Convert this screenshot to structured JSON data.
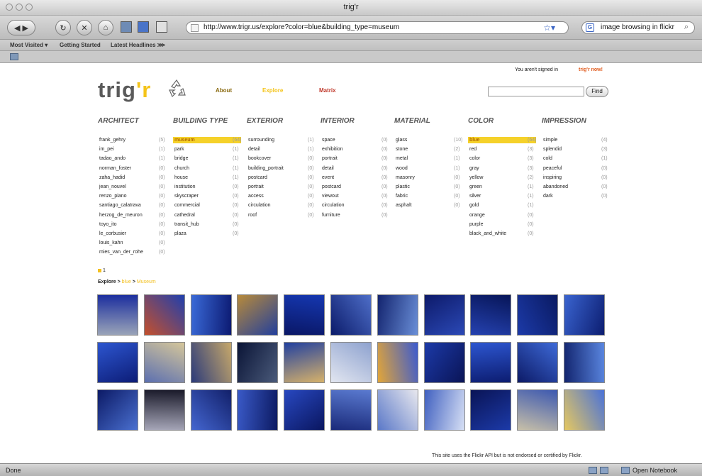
{
  "window": {
    "title": "trig'r"
  },
  "toolbar": {
    "url": "http://www.trigr.us/explore?color=blue&building_type=museum",
    "search": "image browsing in flickr"
  },
  "bookmarks": {
    "most_visited": "Most Visited ▾",
    "getting_started": "Getting Started",
    "latest_headlines": "Latest Headlines ⋙"
  },
  "status": {
    "done": "Done",
    "notebook": "Open Notebook"
  },
  "header": {
    "signin_text": "You aren't signed in",
    "signin_link": "trig'r now!",
    "logo_main": "trig",
    "logo_accent": "'r",
    "nav": [
      {
        "label": "About",
        "color": "#8a6a10"
      },
      {
        "label": "Explore",
        "color": "#f4c41a"
      },
      {
        "label": "Matrix",
        "color": "#c0392b"
      }
    ],
    "find_label": "Find"
  },
  "facets": [
    {
      "title": "ARCHITECT",
      "items": [
        {
          "name": "frank_gehry",
          "count": "(5)"
        },
        {
          "name": "im_pei",
          "count": "(1)"
        },
        {
          "name": "tadao_ando",
          "count": "(1)"
        },
        {
          "name": "norman_foster",
          "count": "(0)"
        },
        {
          "name": "zaha_hadid",
          "count": "(0)"
        },
        {
          "name": "jean_nouvel",
          "count": "(0)"
        },
        {
          "name": "renzo_piano",
          "count": "(0)"
        },
        {
          "name": "santiago_calatrava",
          "count": "(0)"
        },
        {
          "name": "herzog_de_meuron",
          "count": "(0)"
        },
        {
          "name": "toyo_ito",
          "count": "(0)"
        },
        {
          "name": "le_corbusier",
          "count": "(0)"
        },
        {
          "name": "louis_kahn",
          "count": "(0)"
        },
        {
          "name": "mies_van_der_rohe",
          "count": "(0)"
        }
      ]
    },
    {
      "title": "BUILDING TYPE",
      "items": [
        {
          "name": "museum",
          "count": "(64)",
          "selected": true
        },
        {
          "name": "park",
          "count": "(1)"
        },
        {
          "name": "bridge",
          "count": "(1)"
        },
        {
          "name": "church",
          "count": "(1)"
        },
        {
          "name": "house",
          "count": "(1)"
        },
        {
          "name": "institution",
          "count": "(0)"
        },
        {
          "name": "skyscraper",
          "count": "(0)"
        },
        {
          "name": "commercial",
          "count": "(0)"
        },
        {
          "name": "cathedral",
          "count": "(0)"
        },
        {
          "name": "transit_hub",
          "count": "(0)"
        },
        {
          "name": "plaza",
          "count": "(0)"
        }
      ]
    },
    {
      "title": "EXTERIOR",
      "items": [
        {
          "name": "surrounding",
          "count": "(1)"
        },
        {
          "name": "detail",
          "count": "(1)"
        },
        {
          "name": "bookcover",
          "count": "(0)"
        },
        {
          "name": "building_portrait",
          "count": "(0)"
        },
        {
          "name": "postcard",
          "count": "(0)"
        },
        {
          "name": "portrait",
          "count": "(0)"
        },
        {
          "name": "access",
          "count": "(0)"
        },
        {
          "name": "circulation",
          "count": "(0)"
        },
        {
          "name": "roof",
          "count": "(0)"
        }
      ]
    },
    {
      "title": "INTERIOR",
      "items": [
        {
          "name": "space",
          "count": "(0)"
        },
        {
          "name": "exhibition",
          "count": "(0)"
        },
        {
          "name": "portrait",
          "count": "(0)"
        },
        {
          "name": "detail",
          "count": "(0)"
        },
        {
          "name": "event",
          "count": "(0)"
        },
        {
          "name": "postcard",
          "count": "(0)"
        },
        {
          "name": "viewout",
          "count": "(0)"
        },
        {
          "name": "circulation",
          "count": "(0)"
        },
        {
          "name": "furniture",
          "count": "(0)"
        }
      ]
    },
    {
      "title": "MATERIAL",
      "items": [
        {
          "name": "glass",
          "count": "(10)"
        },
        {
          "name": "stone",
          "count": "(2)"
        },
        {
          "name": "metal",
          "count": "(1)"
        },
        {
          "name": "wood",
          "count": "(1)"
        },
        {
          "name": "masonry",
          "count": "(0)"
        },
        {
          "name": "plastic",
          "count": "(0)"
        },
        {
          "name": "fabric",
          "count": "(0)"
        },
        {
          "name": "asphalt",
          "count": "(0)"
        }
      ]
    },
    {
      "title": "COLOR",
      "items": [
        {
          "name": "blue",
          "count": "(64)",
          "selected": true
        },
        {
          "name": "red",
          "count": "(3)"
        },
        {
          "name": "color",
          "count": "(3)"
        },
        {
          "name": "gray",
          "count": "(3)"
        },
        {
          "name": "yellow",
          "count": "(2)"
        },
        {
          "name": "green",
          "count": "(1)"
        },
        {
          "name": "silver",
          "count": "(1)"
        },
        {
          "name": "gold",
          "count": "(1)"
        },
        {
          "name": "orange",
          "count": "(0)"
        },
        {
          "name": "purple",
          "count": "(0)"
        },
        {
          "name": "black_and_white",
          "count": "(0)"
        }
      ]
    },
    {
      "title": "IMPRESSION",
      "items": [
        {
          "name": "simple",
          "count": "(4)"
        },
        {
          "name": "splendid",
          "count": "(3)"
        },
        {
          "name": "cold",
          "count": "(1)"
        },
        {
          "name": "peaceful",
          "count": "(0)"
        },
        {
          "name": "inspiring",
          "count": "(0)"
        },
        {
          "name": "abandoned",
          "count": "(0)"
        },
        {
          "name": "dark",
          "count": "(0)"
        }
      ]
    }
  ],
  "pager": {
    "page": "1"
  },
  "breadcrumb": {
    "root": "Explore > ",
    "color": "blue",
    "sep": " > ",
    "type": "Museum"
  },
  "thumbnails": [
    [
      "#9aa4b8",
      "#1c2e9e"
    ],
    [
      "#c5502c",
      "#1f3fae"
    ],
    [
      "#3a6ad8",
      "#0c1a72"
    ],
    [
      "#b78a3a",
      "#223f9c"
    ],
    [
      "#1537b0",
      "#0a1766"
    ],
    [
      "#4e6ec8",
      "#0b1b6a"
    ],
    [
      "#6a8fd8",
      "#13246f"
    ],
    [
      "#2b49b6",
      "#0d1a6a"
    ],
    [
      "#2542b0",
      "#071558"
    ],
    [
      "#1c3aa8",
      "#0a1a62"
    ],
    [
      "#3a64d0",
      "#0c1d70"
    ],
    [
      "#2d56d0",
      "#0c1c76"
    ],
    [
      "#d6c79a",
      "#5b6fb0"
    ],
    [
      "#c7a86a",
      "#2a3a7a"
    ],
    [
      "#4a5a7a",
      "#0a1436"
    ],
    [
      "#d7b26a",
      "#2140a0"
    ],
    [
      "#e2e6f0",
      "#8ea2cf"
    ],
    [
      "#e3a637",
      "#3a5ad0"
    ],
    [
      "#1c3aa8",
      "#0a1456"
    ],
    [
      "#2d56d0",
      "#0c1c70"
    ],
    [
      "#3e6ad8",
      "#0c1a66"
    ],
    [
      "#5a86e0",
      "#12246e"
    ],
    [
      "#4a70d0",
      "#0c1a66"
    ],
    [
      "#a6a6b8",
      "#1a1a2a"
    ],
    [
      "#4466d0",
      "#12206a"
    ],
    [
      "#3a5ac8",
      "#0c1a62"
    ],
    [
      "#2848c0",
      "#0a1660"
    ],
    [
      "#5a7ad0",
      "#1a2a7a"
    ],
    [
      "#e8e8ee",
      "#5a78c8"
    ],
    [
      "#d7e0f5",
      "#4060c0"
    ],
    [
      "#1c3aa8",
      "#0a1456"
    ],
    [
      "#c8c0a8",
      "#3c58b0"
    ],
    [
      "#e6c860",
      "#4a72d8"
    ]
  ],
  "footer_text": "This site uses the Flickr API but is not endorsed or certified by Flickr."
}
